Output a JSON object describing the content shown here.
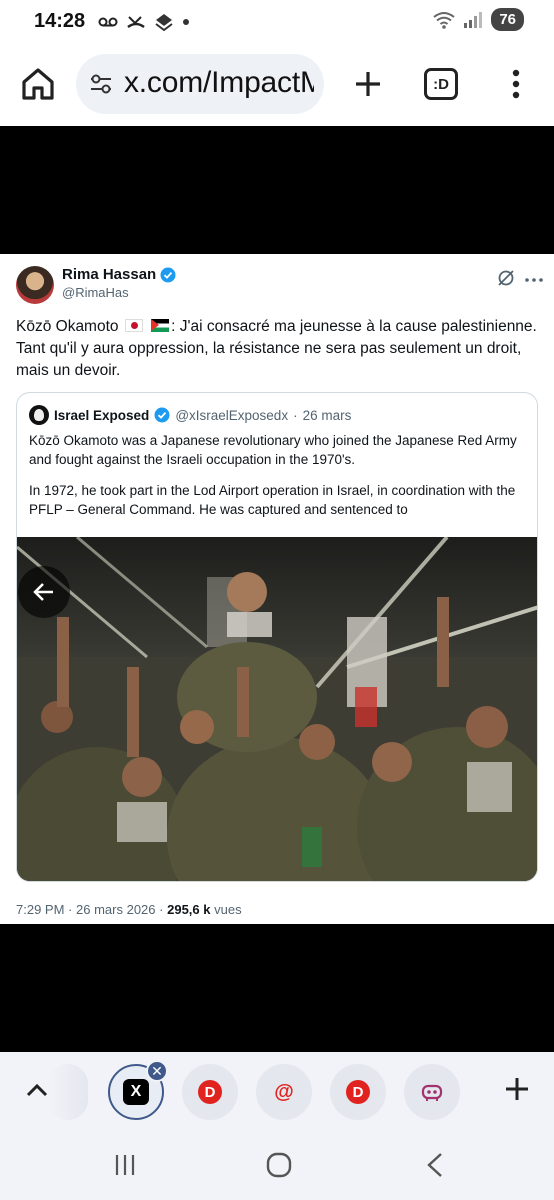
{
  "status_bar": {
    "time": "14:28",
    "battery": "76"
  },
  "browser": {
    "url": "x.com/ImpactM",
    "tab_count_label": ":D"
  },
  "tweet": {
    "author_name": "Rima Hassan",
    "author_handle": "@RimaHas",
    "text_prefix": "Kōzō Okamoto",
    "text_body": ": J'ai consacré ma jeunesse à la cause palestinienne. Tant qu'il y aura oppression, la résistance ne sera pas seulement un droit, mais un devoir.",
    "quote": {
      "author_name": "Israel Exposed",
      "author_handle": "@xIsraelExposedx",
      "separator": "·",
      "date": "26 mars",
      "paragraph_1": "Kōzō Okamoto was a Japanese revolutionary who joined the Japanese Red Army and fought against the Israeli occupation in the 1970's.",
      "paragraph_2": "In 1972, he took part in the Lod Airport operation in Israel, in coordination with the PFLP – General Command. He was captured and sentenced to"
    },
    "meta_time": "7:29 PM",
    "meta_separator": "·",
    "meta_date": "26 mars 2026",
    "meta_views_count": "295,6 k",
    "meta_views_label": "vues"
  },
  "tabs": {
    "items": [
      {
        "icon": "x-logo-icon",
        "label": "X",
        "active": true
      },
      {
        "icon": "d-logo-icon",
        "label": "D"
      },
      {
        "icon": "at-logo-icon",
        "label": "@"
      },
      {
        "icon": "d-logo-icon",
        "label": "D"
      },
      {
        "icon": "robot-logo-icon"
      }
    ]
  },
  "colors": {
    "accent": "#3f5a8a",
    "verified": "#1d9bf0",
    "brand_red": "#e0231f"
  }
}
